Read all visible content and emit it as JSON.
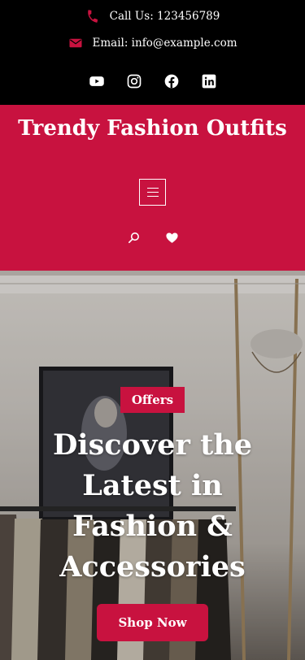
{
  "topbar": {
    "phone_label": "Call Us: 123456789",
    "email_label": "Email: info@example.com",
    "social": [
      "youtube-icon",
      "instagram-icon",
      "facebook-icon",
      "linkedin-icon"
    ]
  },
  "brand": {
    "title": "Trendy Fashion Outfits",
    "menu": "menu-icon",
    "icons": [
      "search-icon",
      "heart-icon"
    ]
  },
  "hero": {
    "badge": "Offers",
    "title": "Discover the Latest in Fashion & Accessories",
    "cta": "Shop Now"
  },
  "colors": {
    "accent": "#c8123f",
    "topbar_bg": "#000000",
    "text": "#ffffff"
  }
}
